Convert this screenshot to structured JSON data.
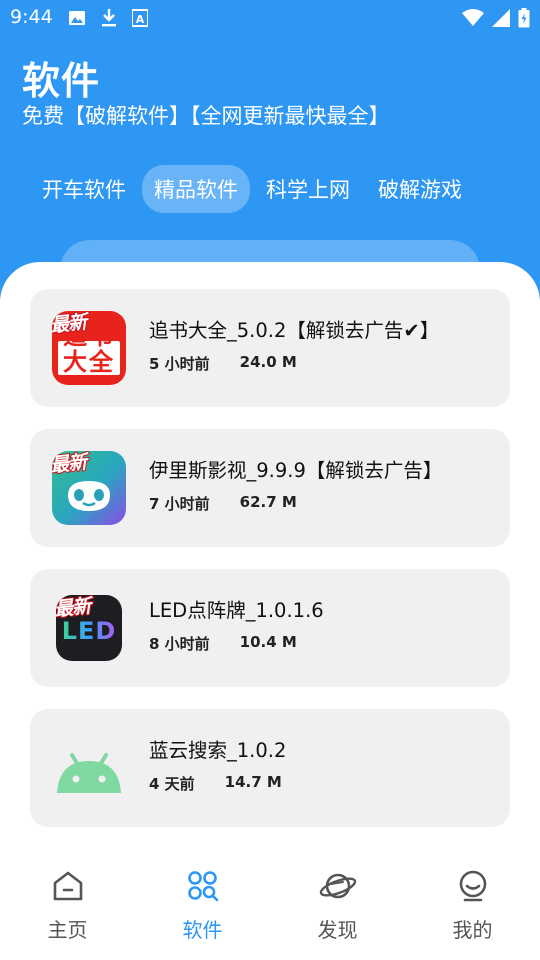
{
  "status_bar": {
    "time": "9:44",
    "left_icons": [
      "image-icon",
      "download-icon",
      "font-icon"
    ],
    "right_icons": [
      "wifi-icon",
      "signal-icon",
      "battery-icon"
    ]
  },
  "header": {
    "title": "软件",
    "subtitle": "免费【破解软件】【全网更新最快最全】"
  },
  "tabs": [
    {
      "label": "开车软件",
      "active": false
    },
    {
      "label": "精品软件",
      "active": true
    },
    {
      "label": "科学上网",
      "active": false
    },
    {
      "label": "破解游戏",
      "active": false
    }
  ],
  "apps": [
    {
      "name": "追书大全_5.0.2【解锁去广告✔】",
      "time": "5 小时前",
      "size": "24.0 M",
      "icon": "book-app-icon",
      "badge": "最新",
      "icon_text": "追书大全"
    },
    {
      "name": "伊里斯影视_9.9.9【解锁去广告】",
      "time": "7 小时前",
      "size": "62.7 M",
      "icon": "panda-app-icon",
      "badge": "最新"
    },
    {
      "name": "LED点阵牌_1.0.1.6",
      "time": "8 小时前",
      "size": "10.4 M",
      "icon": "led-app-icon",
      "badge": "最新",
      "icon_text": "LED"
    },
    {
      "name": "蓝云搜索_1.0.2",
      "time": "4 天前",
      "size": "14.7 M",
      "icon": "android-app-icon"
    }
  ],
  "bottom_nav": [
    {
      "label": "主页",
      "icon": "home-icon",
      "active": false
    },
    {
      "label": "软件",
      "icon": "apps-icon",
      "active": true
    },
    {
      "label": "发现",
      "icon": "planet-icon",
      "active": false
    },
    {
      "label": "我的",
      "icon": "profile-icon",
      "active": false
    }
  ],
  "colors": {
    "primary": "#2e97f3",
    "card_bg": "#f0f0f0",
    "badge_red": "#c8161d"
  }
}
